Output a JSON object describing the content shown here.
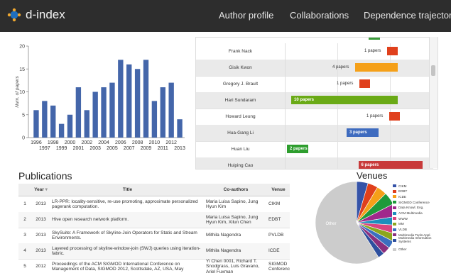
{
  "app": {
    "name": "d-index"
  },
  "nav": {
    "items": [
      "Author profile",
      "Collaborations",
      "Dependence trajectory"
    ]
  },
  "bar_chart": {
    "ylabel": "Num. of papers",
    "y_ticks": [
      "0",
      "5",
      "10",
      "15",
      "20"
    ],
    "x_labels_top": [
      "1996",
      "1998",
      "2000",
      "2002",
      "2004",
      "2006",
      "2008",
      "2010",
      "2012"
    ],
    "x_labels_bottom": [
      "1997",
      "1999",
      "2001",
      "2003",
      "2005",
      "2007",
      "2009",
      "2011",
      "2013"
    ],
    "color": "#4466aa"
  },
  "chart_data": {
    "type": "bar",
    "categories": [
      "1996",
      "1997",
      "1998",
      "1999",
      "2000",
      "2001",
      "2002",
      "2003",
      "2004",
      "2005",
      "2006",
      "2007",
      "2008",
      "2009",
      "2010",
      "2011",
      "2012",
      "2013"
    ],
    "values": [
      6,
      8,
      7,
      3,
      5,
      11,
      6,
      10,
      11,
      12,
      17,
      16,
      15,
      17,
      8,
      11,
      12,
      4
    ],
    "xlabel": "",
    "ylabel": "Num. of papers",
    "ylim": [
      0,
      20
    ],
    "grid": false
  },
  "collaborators": {
    "rows": [
      {
        "name": "Frank Nack",
        "label": "1 papers",
        "papers": 1,
        "color": "#e0401c",
        "text_inside": false
      },
      {
        "name": "Gisik Kwon",
        "label": "4 papers",
        "papers": 4,
        "color": "#f5a019",
        "text_inside": false
      },
      {
        "name": "Gregory J. Brault",
        "label": "1 papers",
        "papers": 1,
        "color": "#e0401c",
        "text_inside": false
      },
      {
        "name": "Hari Sundaram",
        "label": "10 papers",
        "papers": 10,
        "color": "#6aaa16",
        "text_inside": true
      },
      {
        "name": "Howard Leung",
        "label": "1 papers",
        "papers": 1,
        "color": "#e0401c",
        "text_inside": false
      },
      {
        "name": "Hua-Gang Li",
        "label": "3 papers",
        "papers": 3,
        "color": "#3e6bbf",
        "text_inside": true
      },
      {
        "name": "Huan Liu",
        "label": "2 papers",
        "papers": 2,
        "color": "#2e9e2e",
        "text_inside": true
      },
      {
        "name": "Huiping Cao",
        "label": "6 papers",
        "papers": 6,
        "color": "#c83b3b",
        "text_inside": true
      }
    ]
  },
  "publications": {
    "title": "Publications",
    "columns": [
      "",
      "Year",
      "Title",
      "Co-authors",
      "Venue"
    ],
    "sort_icon": "sort-arrow-icon",
    "rows": [
      {
        "n": "1",
        "year": "2013",
        "title": "LR-PPR: locality-sensitive, re-use promoting, approximate personalized pagerank computation.",
        "coauthors": "Maria Luisa Sapino, Jung Hyun Kim",
        "venue": "CIKM"
      },
      {
        "n": "2",
        "year": "2013",
        "title": "Hive open research network platform.",
        "coauthors": "Maria Luisa Sapino, Jung Hyun Kim, Xilun Chen",
        "venue": "EDBT"
      },
      {
        "n": "3",
        "year": "2013",
        "title": "SkySuite: A Framework of Skyline-Join Operators for Static and Stream Environments.",
        "coauthors": "Mithila Nagendra",
        "venue": "PVLDB"
      },
      {
        "n": "4",
        "year": "2013",
        "title": "Layered processing of skyline-window-join (SWJ) queries using iteration-fabric.",
        "coauthors": "Mithila Nagendra",
        "venue": "ICDE"
      },
      {
        "n": "5",
        "year": "2012",
        "title": "Proceedings of the ACM SIGMOD International Conference on Management of Data, SIGMOD 2012, Scottsdale, AZ, USA, May",
        "coauthors": "Yi Chen 0001, Richard T. Snodgrass, Luis Gravano, Ariel Fuxman",
        "venue": "SIGMOD Conference"
      }
    ]
  },
  "venues": {
    "title": "Venues",
    "other_label": "Other",
    "legend": [
      {
        "label": "CIKM",
        "color": "#3553a8"
      },
      {
        "label": "EDBT",
        "color": "#e0401c"
      },
      {
        "label": "ICDE",
        "color": "#f5a019"
      },
      {
        "label": "SIGMOD Conference",
        "color": "#1e9a3a"
      },
      {
        "label": "Data Knowl. Eng.",
        "color": "#a0288c"
      },
      {
        "label": "ACM Multimedia",
        "color": "#1c8fbd"
      },
      {
        "label": "WWW",
        "color": "#d9457e"
      },
      {
        "label": "MM",
        "color": "#8ca61e"
      },
      {
        "label": "VLDB",
        "color": "#3b6fbf"
      },
      {
        "label": "Multimedia Tools Appl.",
        "color": "#8a2f7e"
      },
      {
        "label": "Multimedia Information Systems",
        "color": "#2d4f9e"
      },
      {
        "label": "Other",
        "color": "#cccccc"
      }
    ],
    "slices": [
      {
        "label": "CIKM",
        "value": 4.5,
        "color": "#3553a8"
      },
      {
        "label": "EDBT",
        "value": 4.0,
        "color": "#e0401c"
      },
      {
        "label": "ICDE",
        "value": 4.0,
        "color": "#f5a019"
      },
      {
        "label": "SIGMOD Conference",
        "value": 5.0,
        "color": "#1e9a3a"
      },
      {
        "label": "Data Knowl. Eng.",
        "value": 5.0,
        "color": "#a0288c"
      },
      {
        "label": "ACM Multimedia",
        "value": 3.5,
        "color": "#1c8fbd"
      },
      {
        "label": "WWW",
        "value": 3.5,
        "color": "#d9457e"
      },
      {
        "label": "MM",
        "value": 3.0,
        "color": "#8ca61e"
      },
      {
        "label": "VLDB",
        "value": 3.0,
        "color": "#3b6fbf"
      },
      {
        "label": "Multimedia Tools Appl.",
        "value": 3.0,
        "color": "#8a2f7e"
      },
      {
        "label": "Multimedia Information Systems",
        "value": 2.5,
        "color": "#2d4f9e"
      },
      {
        "label": "Other",
        "value": 59.0,
        "color": "#cccccc"
      }
    ]
  }
}
